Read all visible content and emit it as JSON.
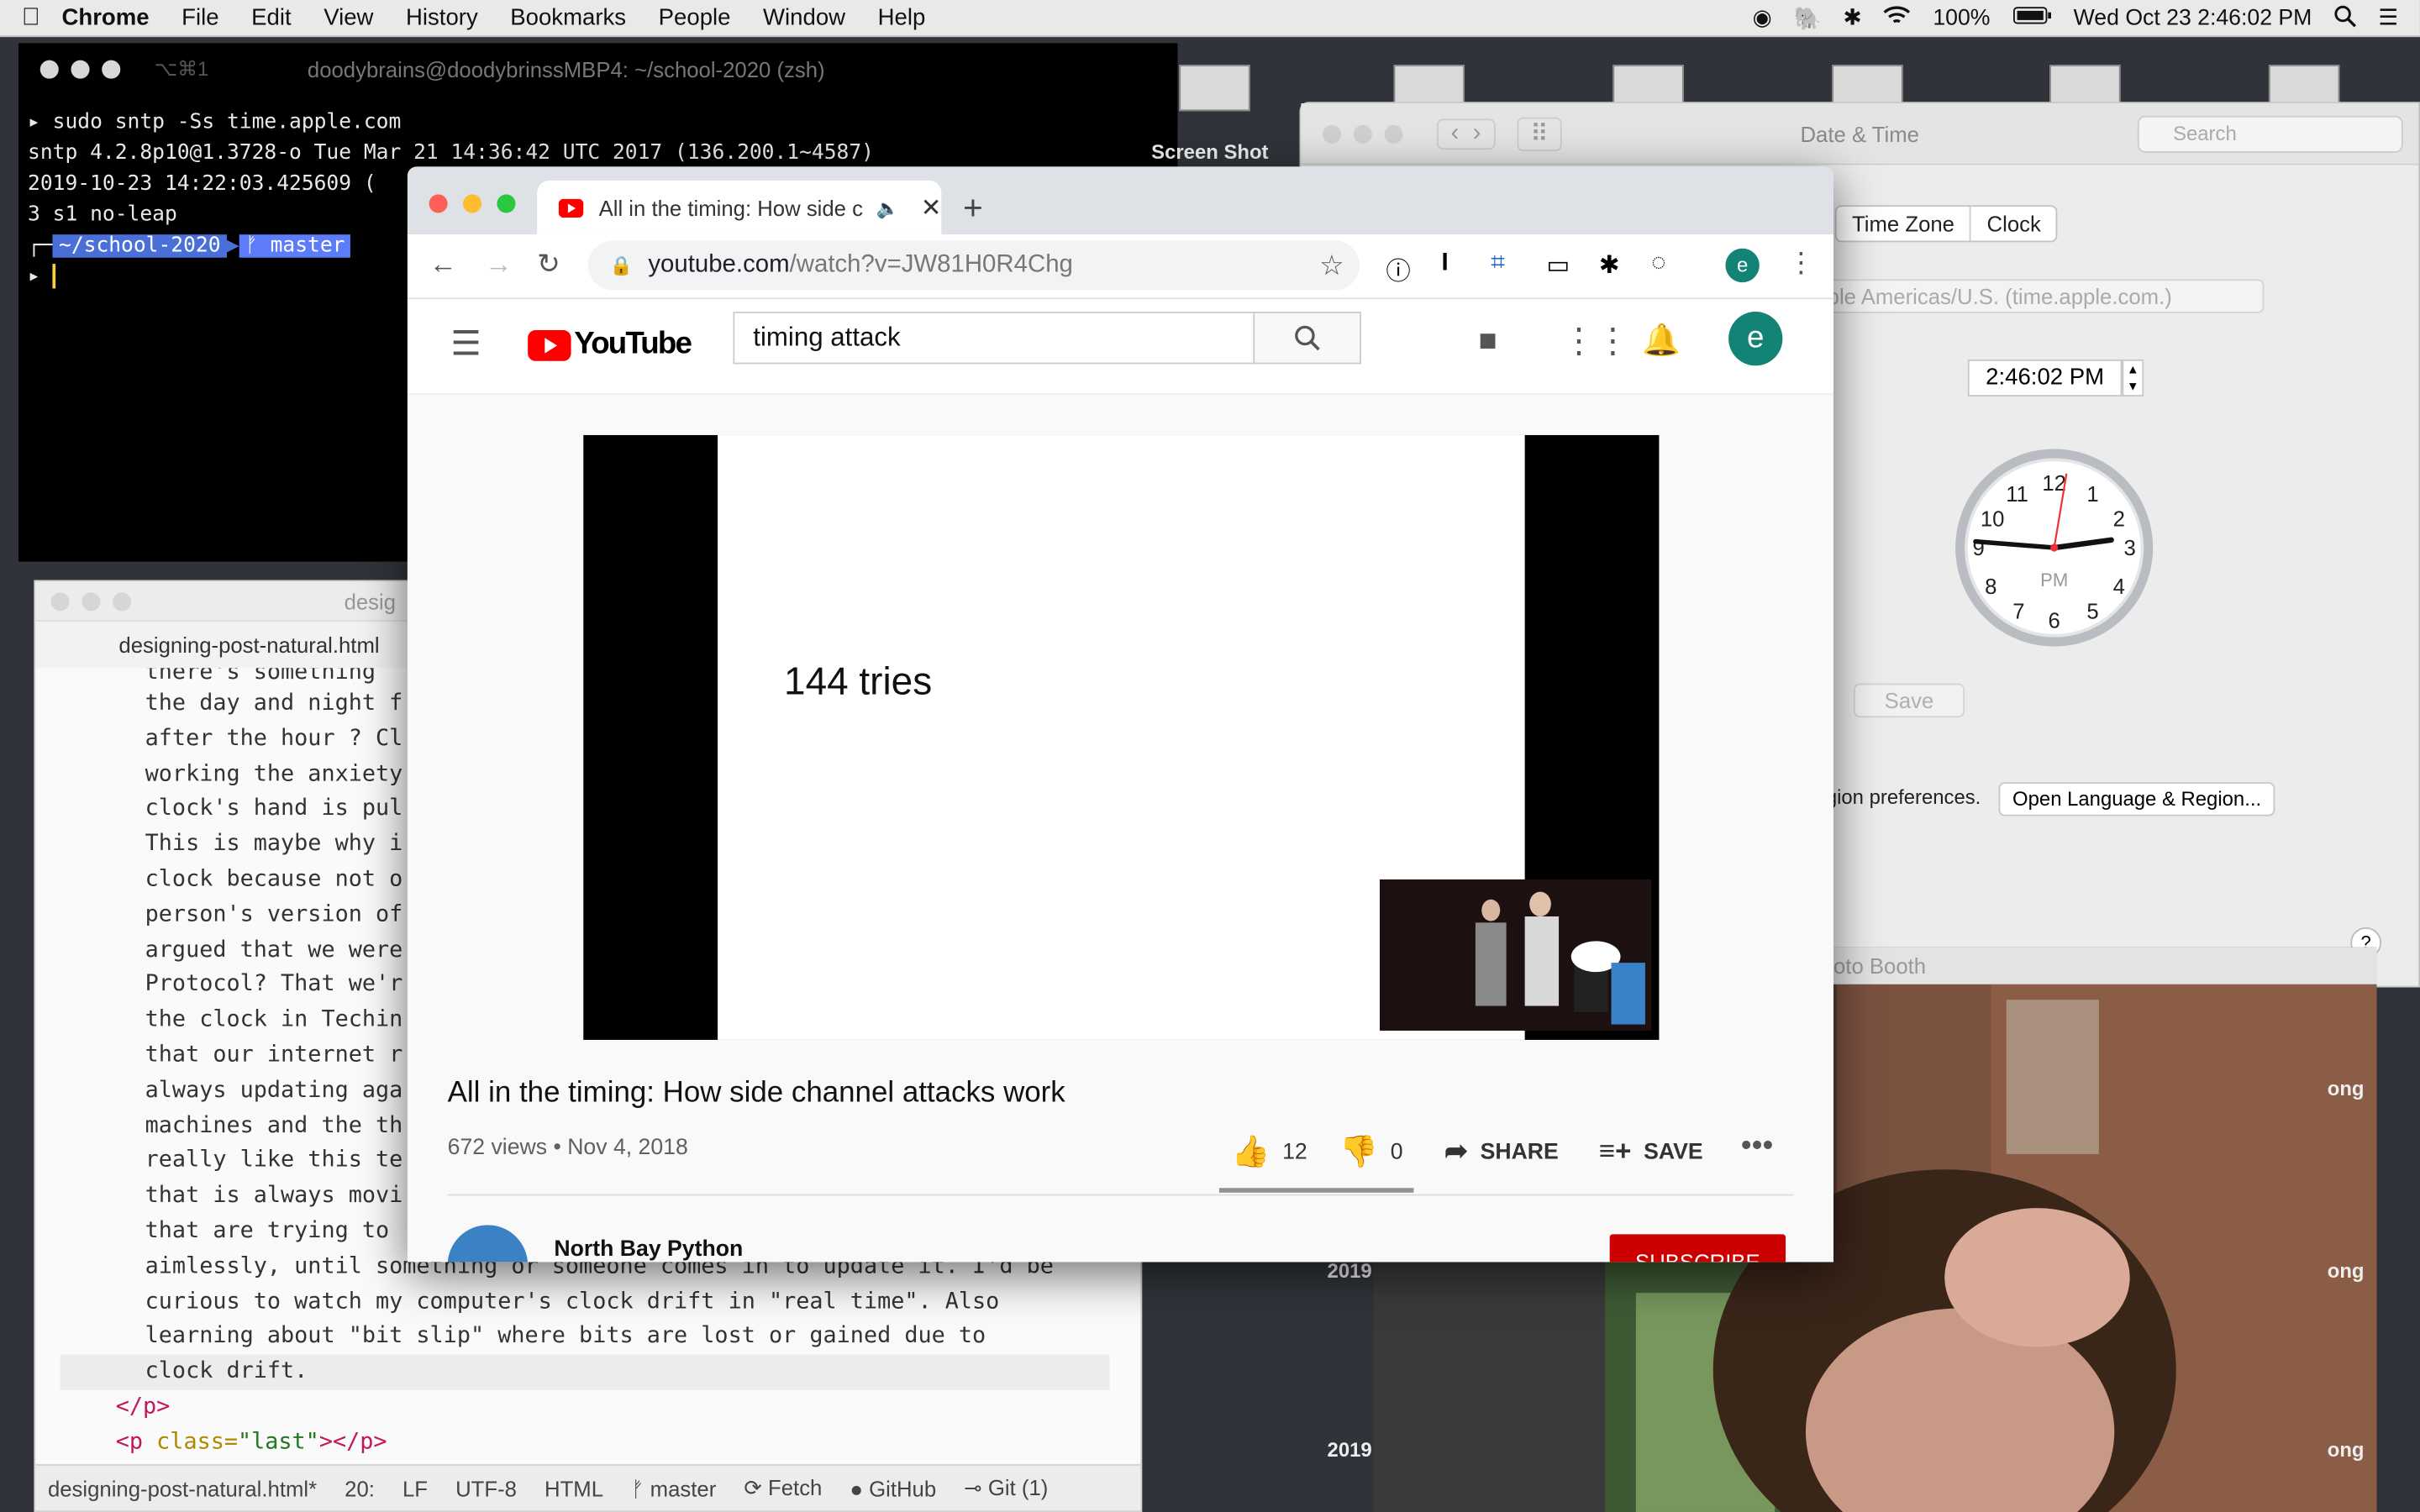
{
  "menubar": {
    "app": "Chrome",
    "items": [
      "File",
      "Edit",
      "View",
      "History",
      "Bookmarks",
      "People",
      "Window",
      "Help"
    ],
    "battery": "100%",
    "datetime": "Wed Oct 23  2:46:02 PM"
  },
  "terminal": {
    "shortcut": "⌥⌘1",
    "title": "doodybrains@doodybrinssMBP4: ~/school-2020 (zsh)",
    "lines": [
      "▸ sudo sntp -Ss time.apple.com",
      "sntp 4.2.8p10@1.3728-o Tue Mar 21 14:36:42 UTC 2017 (136.200.1~4587)",
      "2019-10-23 14:22:03.425609 (",
      "3 s1 no-leap"
    ],
    "prompt_dir": "~/school-2020",
    "prompt_branch": "ᚠ master",
    "cursor_line": "▸"
  },
  "screenshot_label": "Screen Shot",
  "datetime_prefs": {
    "title": "Date & Time",
    "search_placeholder": "Search",
    "tabs": [
      "Time Zone",
      "Clock"
    ],
    "server": "ple Americas/U.S. (time.apple.com.)",
    "time_value": "2:46:02 PM",
    "clock_numbers": [
      "12",
      "1",
      "2",
      "3",
      "4",
      "5",
      "6",
      "7",
      "8",
      "9",
      "10",
      "11"
    ],
    "clock_ampm": "PM",
    "save_label": "Save",
    "region_text": "gion preferences.",
    "open_region_button": "Open Language & Region...",
    "help": "?"
  },
  "photobooth": {
    "title": "oto Booth",
    "side_labels": [
      "ong",
      "ong",
      "ong"
    ],
    "left_labels": [
      "2019",
      "2019"
    ]
  },
  "editor": {
    "title": "desig",
    "tab": "designing-post-natural.html",
    "lines": [
      "there's something ",
      "the day and night f",
      "after the hour ? Cl",
      "working the anxiety",
      "clock's hand is pul",
      "This is maybe why i",
      "clock because not o",
      "person's version of",
      "argued that we were",
      "Protocol? That we'r",
      "the clock in Techin",
      "that our internet r",
      "always updating aga",
      "machines and the th",
      "really like this te",
      "that is always movi",
      "that are trying to ",
      "aimlessly, until something or someone comes in to update it. I'd be",
      "curious to watch my computer's clock drift in \"real time\". Also",
      "learning about \"bit slip\" where bits are lost or gained due to",
      "clock drift."
    ],
    "close_p": "</p>",
    "last_p_open": "<p ",
    "last_p_attr": "class=",
    "last_p_val": "\"last\"",
    "last_p_close": "></p>",
    "status": {
      "file": "designing-post-natural.html*",
      "line": "20:",
      "eol": "LF",
      "encoding": "UTF-8",
      "grammar": "HTML",
      "branch": "master",
      "fetch": "Fetch",
      "github": "GitHub",
      "git": "Git (1)"
    }
  },
  "chrome": {
    "tab_title": "All in the timing: How side c",
    "url_host": "youtube.com",
    "url_path": "/watch?v=JW81H0R4Chg",
    "profile": "e"
  },
  "youtube": {
    "logo": "YouTube",
    "search_value": "timing attack",
    "avatar": "e",
    "slide_text": "144 tries",
    "video_title": "All in the timing: How side channel attacks work",
    "views": "672 views • Nov 4, 2018",
    "likes": "12",
    "dislikes": "0",
    "share": "SHARE",
    "save": "SAVE",
    "channel": "North Bay Python",
    "subscribe": "SUBSCRIBE"
  },
  "colors": {
    "youtube_red": "#ff0000",
    "avatar_teal": "#138376",
    "subscribe_red": "#cc0000",
    "prompt_blue": "#4a6fd8"
  }
}
